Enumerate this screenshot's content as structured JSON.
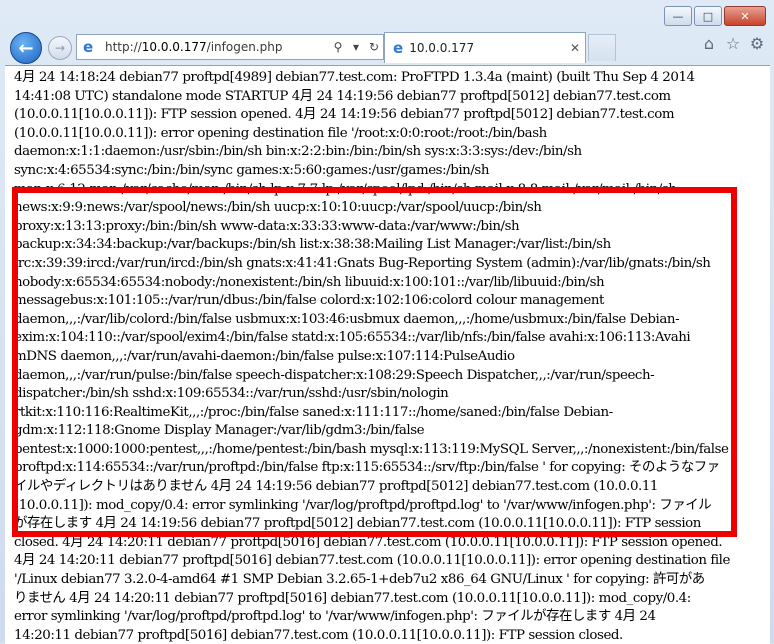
{
  "browser": {
    "address": {
      "prefix": "http://",
      "host": "10.0.0.177",
      "path": "/infogen.php"
    },
    "tab": {
      "label": "10.0.0.177"
    }
  },
  "log_lines": [
    "4月 24 14:18:24 debian77 proftpd[4989] debian77.test.com: ProFTPD 1.3.4a (maint) (built Thu Sep 4 2014",
    "14:41:08 UTC) standalone mode STARTUP 4月 24 14:19:56 debian77 proftpd[5012] debian77.test.com",
    "(10.0.0.11[10.0.0.11]): FTP session opened. 4月 24 14:19:56 debian77 proftpd[5012] debian77.test.com",
    "(10.0.0.11[10.0.0.11]): error opening destination file '/root:x:0:0:root:/root:/bin/bash",
    "daemon:x:1:1:daemon:/usr/sbin:/bin/sh bin:x:2:2:bin:/bin:/bin/sh sys:x:3:3:sys:/dev:/bin/sh",
    "sync:x:4:65534:sync:/bin:/bin/sync games:x:5:60:games:/usr/games:/bin/sh",
    "man:x:6:12:man:/var/cache/man:/bin/sh lp:x:7:7:lp:/var/spool/lpd:/bin/sh mail:x:8:8:mail:/var/mail:/bin/sh",
    "news:x:9:9:news:/var/spool/news:/bin/sh uucp:x:10:10:uucp:/var/spool/uucp:/bin/sh",
    "proxy:x:13:13:proxy:/bin:/bin/sh www-data:x:33:33:www-data:/var/www:/bin/sh",
    "backup:x:34:34:backup:/var/backups:/bin/sh list:x:38:38:Mailing List Manager:/var/list:/bin/sh",
    "irc:x:39:39:ircd:/var/run/ircd:/bin/sh gnats:x:41:41:Gnats Bug-Reporting System (admin):/var/lib/gnats:/bin/sh",
    "nobody:x:65534:65534:nobody:/nonexistent:/bin/sh libuuid:x:100:101::/var/lib/libuuid:/bin/sh",
    "messagebus:x:101:105::/var/run/dbus:/bin/false colord:x:102:106:colord colour management",
    "daemon,,,:/var/lib/colord:/bin/false usbmux:x:103:46:usbmux daemon,,,:/home/usbmux:/bin/false Debian-",
    "exim:x:104:110::/var/spool/exim4:/bin/false statd:x:105:65534::/var/lib/nfs:/bin/false avahi:x:106:113:Avahi",
    "mDNS daemon,,,:/var/run/avahi-daemon:/bin/false pulse:x:107:114:PulseAudio",
    "daemon,,,:/var/run/pulse:/bin/false speech-dispatcher:x:108:29:Speech Dispatcher,,,:/var/run/speech-",
    "dispatcher:/bin/sh sshd:x:109:65534::/var/run/sshd:/usr/sbin/nologin",
    "rtkit:x:110:116:RealtimeKit,,,:/proc:/bin/false saned:x:111:117::/home/saned:/bin/false Debian-",
    "gdm:x:112:118:Gnome Display Manager:/var/lib/gdm3:/bin/false",
    "pentest:x:1000:1000:pentest,,,:/home/pentest:/bin/bash mysql:x:113:119:MySQL Server,,,:/nonexistent:/bin/false",
    "proftpd:x:114:65534::/var/run/proftpd:/bin/false ftp:x:115:65534::/srv/ftp:/bin/false ' for copying: そのようなファ",
    "イルやディレクトリはありません 4月 24 14:19:56 debian77 proftpd[5012] debian77.test.com (10.0.0.11",
    "[10.0.0.11]): mod_copy/0.4: error symlinking '/var/log/proftpd/proftpd.log' to '/var/www/infogen.php': ファイル",
    "が存在します 4月 24 14:19:56 debian77 proftpd[5012] debian77.test.com (10.0.0.11[10.0.0.11]): FTP session",
    "closed. 4月 24 14:20:11 debian77 proftpd[5016] debian77.test.com (10.0.0.11[10.0.0.11]): FTP session opened.",
    "4月 24 14:20:11 debian77 proftpd[5016] debian77.test.com (10.0.0.11[10.0.0.11]): error opening destination file",
    "'/Linux debian77 3.2.0-4-amd64 #1 SMP Debian 3.2.65-1+deb7u2 x86_64 GNU/Linux ' for copying: 許可があ",
    "りません 4月 24 14:20:11 debian77 proftpd[5016] debian77.test.com (10.0.0.11[10.0.0.11]): mod_copy/0.4:",
    "error symlinking '/var/log/proftpd/proftpd.log' to '/var/www/infogen.php': ファイルが存在します 4月 24",
    "14:20:11 debian77 proftpd[5016] debian77.test.com (10.0.0.11[10.0.0.11]): FTP session closed."
  ],
  "colors": {
    "highlight": "#ef0000",
    "accent": "#1c62c4"
  }
}
